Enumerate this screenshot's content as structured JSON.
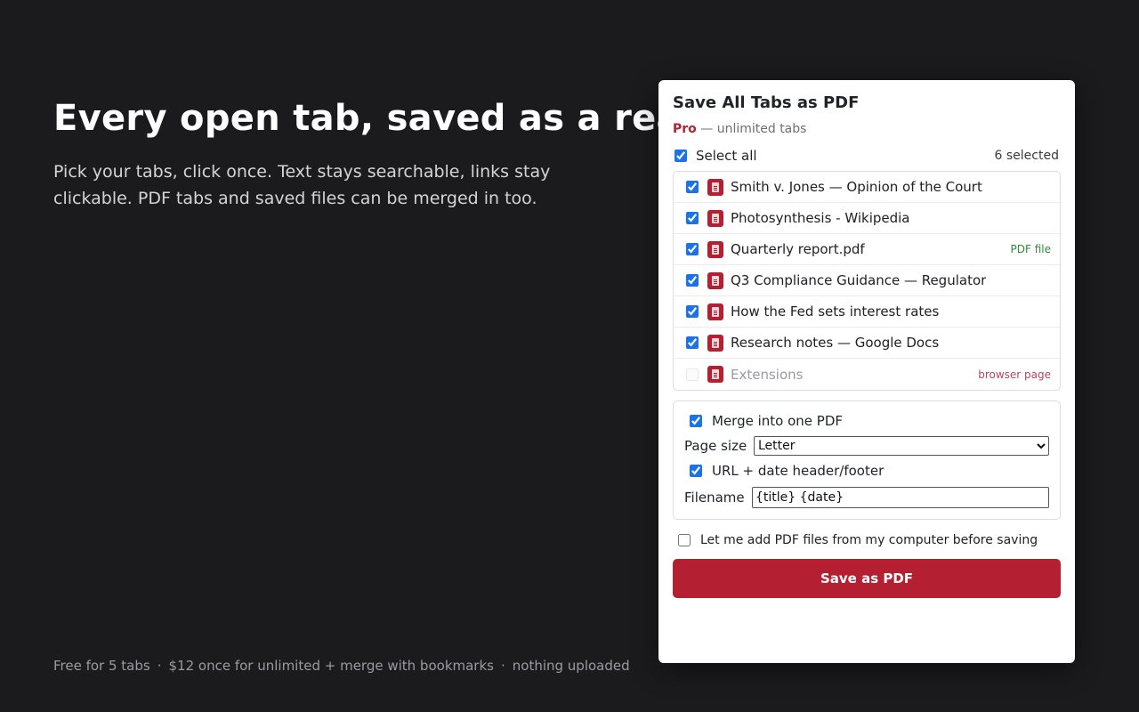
{
  "hero": {
    "title": "Every open tab, saved as a real PDF.",
    "subtitle": "Pick your tabs, click once. Text stays searchable, links stay clickable. PDF tabs and saved files can be merged in too."
  },
  "footer": {
    "items": [
      "Free for 5 tabs",
      "$12 once for unlimited + merge with bookmarks",
      "nothing uploaded"
    ],
    "separator": "·"
  },
  "popup": {
    "title": "Save All Tabs as PDF",
    "plan_badge": "Pro",
    "plan_text": "— unlimited tabs",
    "select_all_label": "Select all",
    "selected_count": "6 selected",
    "tabs": [
      {
        "title": "Smith v. Jones — Opinion of the Court",
        "checked": true,
        "tag": ""
      },
      {
        "title": "Photosynthesis - Wikipedia",
        "checked": true,
        "tag": ""
      },
      {
        "title": "Quarterly report.pdf",
        "checked": true,
        "tag": "PDF file"
      },
      {
        "title": "Q3 Compliance Guidance — Regulator",
        "checked": true,
        "tag": ""
      },
      {
        "title": "How the Fed sets interest rates",
        "checked": true,
        "tag": ""
      },
      {
        "title": "Research notes — Google Docs",
        "checked": true,
        "tag": ""
      },
      {
        "title": "Extensions",
        "checked": false,
        "tag": "browser page"
      }
    ],
    "options": {
      "merge_label": "Merge into one PDF",
      "page_size_label": "Page size",
      "page_size_value": "Letter",
      "header_footer_label": "URL + date header/footer",
      "filename_label": "Filename",
      "filename_value": "{title} {date}"
    },
    "local_files_label": "Let me add PDF files from my computer before saving",
    "save_button": "Save as PDF"
  },
  "colors": {
    "accent": "#b42032",
    "checkbox": "#1a73e8",
    "pdf_tag": "#2e8b3a",
    "browser_tag": "#b4475a",
    "background": "#1b1b1e"
  }
}
